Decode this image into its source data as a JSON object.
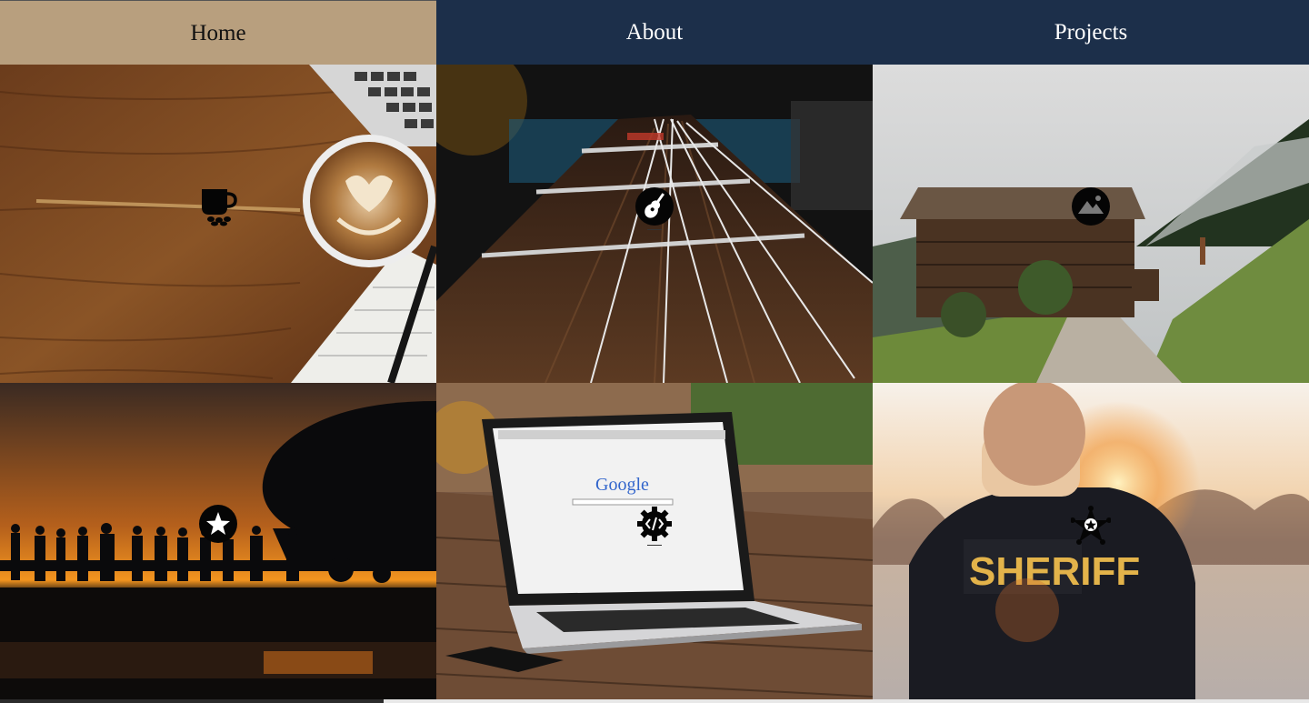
{
  "nav": {
    "items": [
      {
        "label": "Home"
      },
      {
        "label": "About"
      },
      {
        "label": "Projects"
      }
    ]
  },
  "tiles": [
    {
      "photo": "coffee on wooden desk",
      "icon": "coffee-cup-icon"
    },
    {
      "photo": "guitar fretboard",
      "icon": "guitar-icon"
    },
    {
      "photo": "wooden barn landscape",
      "icon": "mountain-icon"
    },
    {
      "photo": "soldiers boarding aircraft at sunset",
      "icon": "star-icon"
    },
    {
      "photo": "laptop with Google on table",
      "icon": "code-gear-icon"
    },
    {
      "photo": "sheriff officer at sunset",
      "icon": "sheriff-badge-icon"
    }
  ],
  "screen_texts": {
    "google": "Google",
    "sheriff": "SHERIFF"
  },
  "colors": {
    "home_tab": "#b89f7e",
    "nav_bg": "#1c2f4a"
  }
}
